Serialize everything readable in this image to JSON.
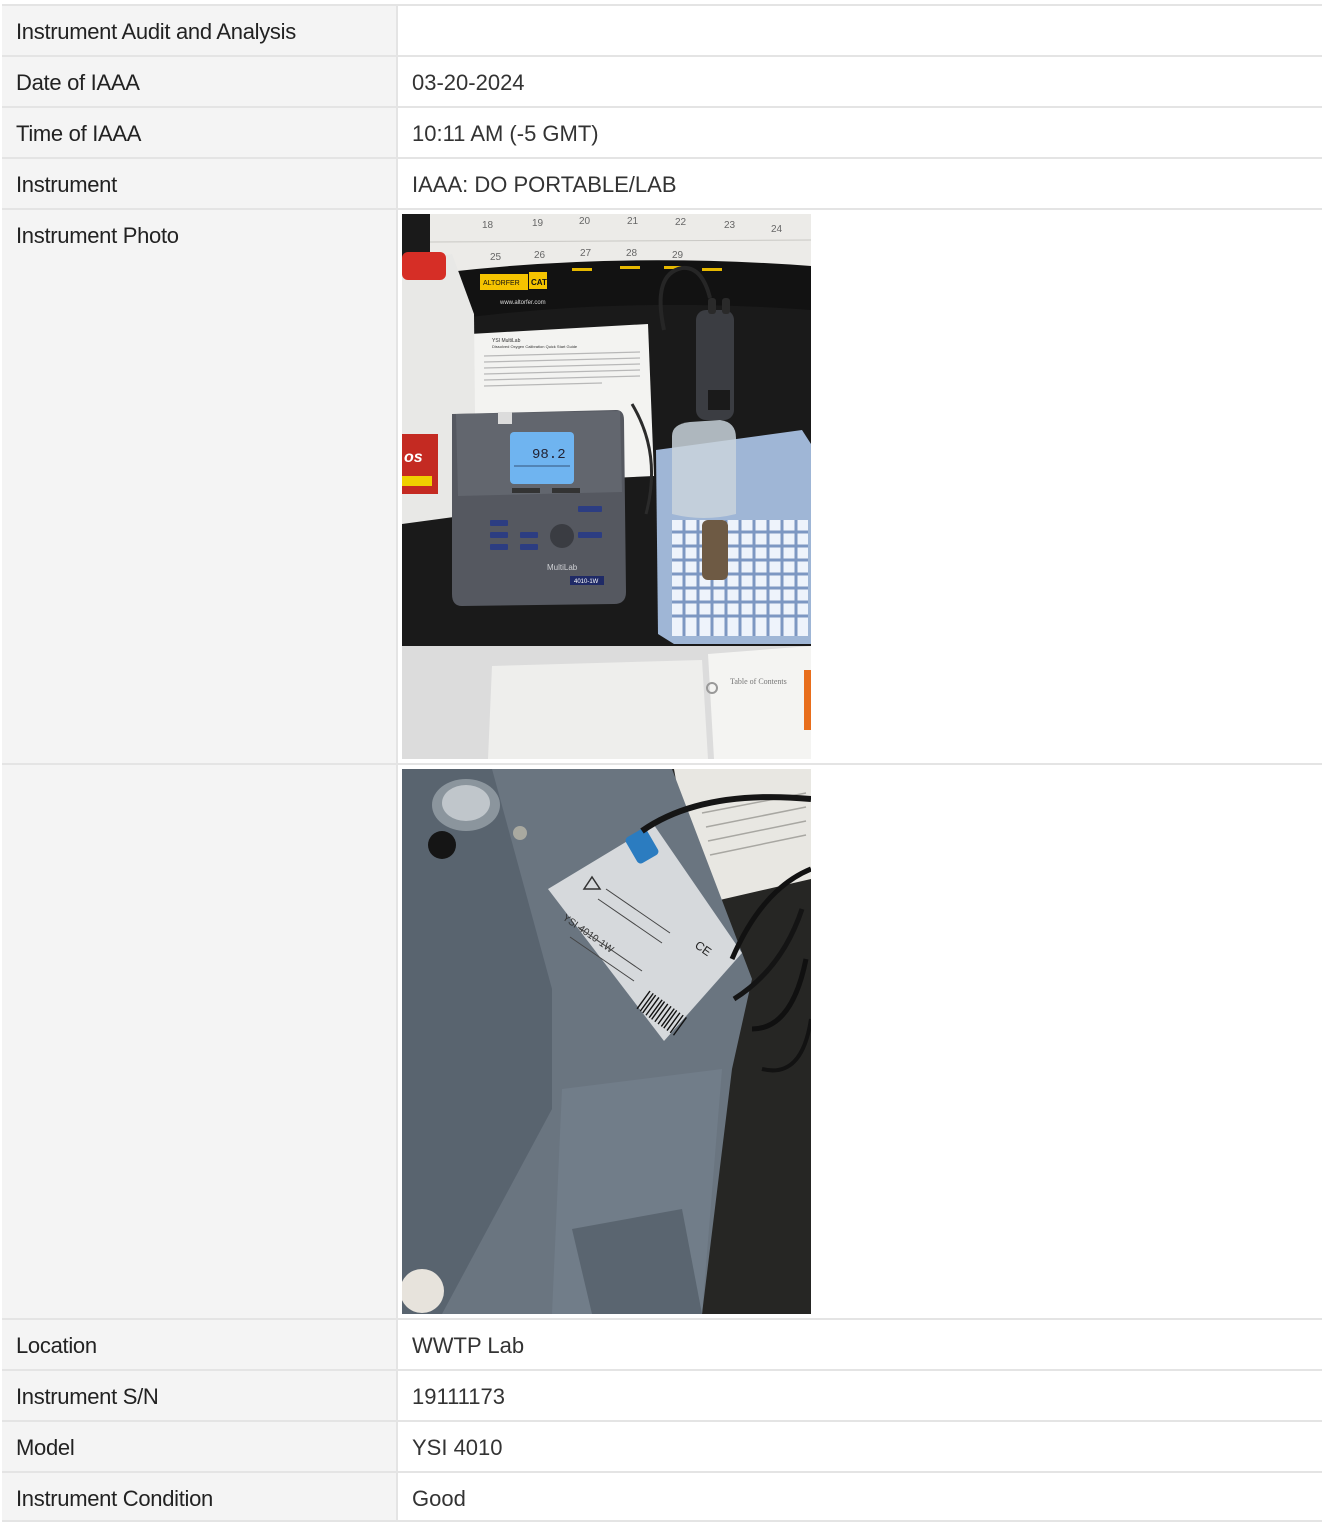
{
  "table": {
    "title_label": "Instrument Audit and Analysis",
    "title_value": "",
    "rows": [
      {
        "label": "Date of IAAA",
        "value": "03-20-2024"
      },
      {
        "label": "Time of IAAA",
        "value": "10:11 AM (-5 GMT)"
      },
      {
        "label": "Instrument",
        "value": "IAAA: DO PORTABLE/LAB"
      }
    ],
    "photo": {
      "label": "Instrument Photo",
      "meter_reading": "98.2",
      "meter_model": "4010-1W",
      "meter_brand": "MultiLab",
      "guide_title": "YSI MultiLab",
      "guide_subtitle": "Dissolved Oxygen Calibration Quick Start Guide",
      "calendar_brand": "ALTORFER",
      "calendar_cat": "CAT",
      "calendar_url": "www.altorfer.com",
      "calendar_days": [
        "18",
        "19",
        "20",
        "21",
        "22",
        "23",
        "24",
        "25",
        "26",
        "27",
        "28",
        "29"
      ],
      "binder_text": "Table of Contents",
      "label_model": "YSI 4010-1W",
      "label_ce": "CE"
    },
    "rows_after": [
      {
        "label": "Location",
        "value": "WWTP Lab"
      },
      {
        "label": "Instrument S/N",
        "value": "19111173"
      },
      {
        "label": "Model",
        "value": "YSI 4010"
      },
      {
        "label": "Instrument Condition",
        "value": "Good"
      }
    ]
  },
  "colors": {
    "label_bg": "#f4f4f4",
    "border": "#e4e4e4",
    "text": "#222222"
  }
}
